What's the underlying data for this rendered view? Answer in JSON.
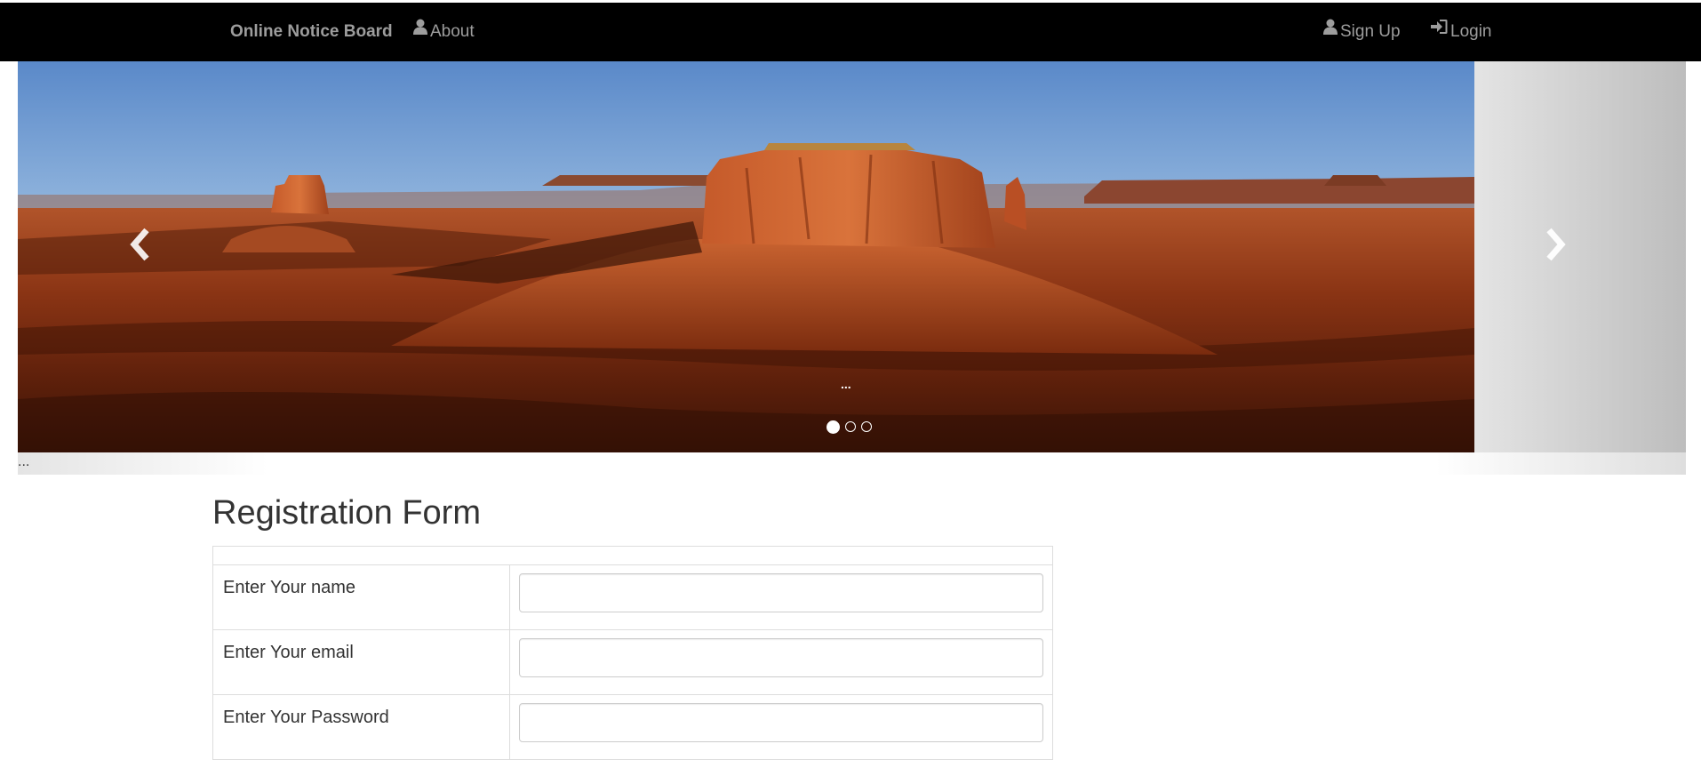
{
  "navbar": {
    "brand": "Online Notice Board",
    "about": "About",
    "signup": "Sign Up",
    "login": "Login",
    "bg_color": "#000000",
    "link_color": "#9d9d9d"
  },
  "carousel": {
    "slide_caption": "...",
    "strip_caption": "...",
    "active_slide": 1,
    "slide_count": 3,
    "left_icon": "chevron-left-icon",
    "right_icon": "chevron-right-icon"
  },
  "form": {
    "title": "Registration Form",
    "fields": [
      {
        "label": "Enter Your name",
        "value": "",
        "type": "text"
      },
      {
        "label": "Enter Your email",
        "value": "",
        "type": "email"
      },
      {
        "label": "Enter Your Password",
        "value": "",
        "type": "password"
      }
    ]
  }
}
